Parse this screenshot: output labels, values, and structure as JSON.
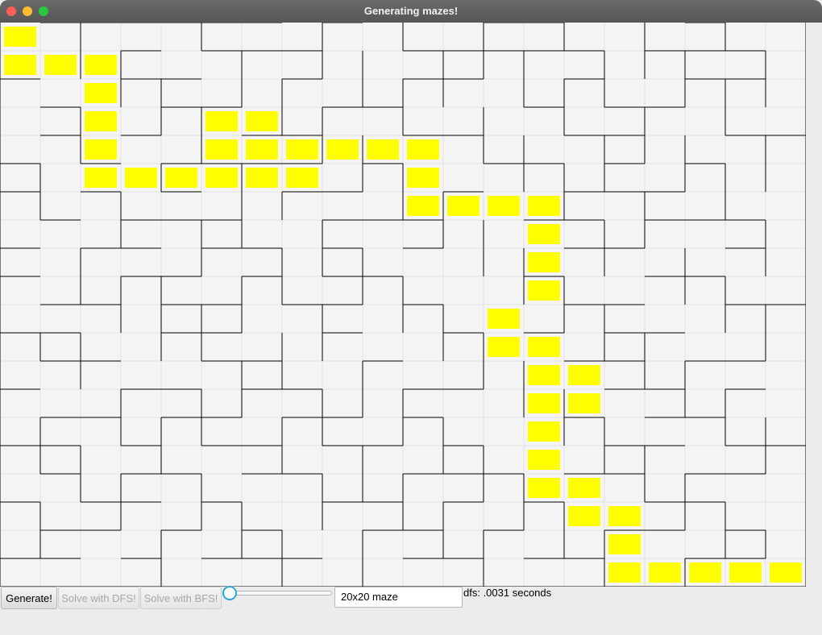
{
  "window": {
    "title": "Generating mazes!"
  },
  "colors": {
    "path": "#ffff00",
    "wall": "#000000",
    "cell_bg": "#f4f4f4",
    "grid_line": "#e2e2e2"
  },
  "maze": {
    "rows": 20,
    "cols": 20,
    "solution_path": [
      [
        0,
        0
      ],
      [
        1,
        0
      ],
      [
        1,
        1
      ],
      [
        1,
        2
      ],
      [
        2,
        2
      ],
      [
        3,
        2
      ],
      [
        4,
        2
      ],
      [
        5,
        2
      ],
      [
        5,
        3
      ],
      [
        5,
        4
      ],
      [
        5,
        5
      ],
      [
        4,
        5
      ],
      [
        3,
        5
      ],
      [
        3,
        6
      ],
      [
        4,
        6
      ],
      [
        5,
        6
      ],
      [
        5,
        7
      ],
      [
        4,
        7
      ],
      [
        4,
        8
      ],
      [
        4,
        9
      ],
      [
        4,
        10
      ],
      [
        5,
        10
      ],
      [
        6,
        10
      ],
      [
        6,
        11
      ],
      [
        6,
        12
      ],
      [
        6,
        13
      ],
      [
        7,
        13
      ],
      [
        8,
        13
      ],
      [
        9,
        13
      ],
      [
        10,
        12
      ],
      [
        11,
        12
      ],
      [
        11,
        13
      ],
      [
        12,
        13
      ],
      [
        12,
        14
      ],
      [
        13,
        14
      ],
      [
        13,
        13
      ],
      [
        14,
        13
      ],
      [
        15,
        13
      ],
      [
        16,
        13
      ],
      [
        16,
        14
      ],
      [
        17,
        14
      ],
      [
        17,
        15
      ],
      [
        18,
        15
      ],
      [
        19,
        15
      ],
      [
        19,
        16
      ],
      [
        19,
        17
      ],
      [
        19,
        18
      ],
      [
        19,
        19
      ]
    ],
    "horizontal_walls": [
      [
        0,
        1,
        7
      ],
      [
        0,
        8,
        9
      ],
      [
        0,
        12,
        14
      ],
      [
        0,
        17,
        18
      ],
      [
        1,
        3,
        4
      ],
      [
        1,
        5,
        8
      ],
      [
        1,
        10,
        15
      ],
      [
        1,
        16,
        19
      ],
      [
        2,
        0,
        1
      ],
      [
        2,
        3,
        5
      ],
      [
        2,
        7,
        8
      ],
      [
        2,
        10,
        12
      ],
      [
        2,
        14,
        15
      ],
      [
        2,
        17,
        19
      ],
      [
        3,
        1,
        2
      ],
      [
        3,
        4,
        6
      ],
      [
        3,
        8,
        10
      ],
      [
        3,
        13,
        14
      ],
      [
        3,
        15,
        17
      ],
      [
        4,
        1,
        2
      ],
      [
        4,
        3,
        4
      ],
      [
        4,
        6,
        8
      ],
      [
        4,
        10,
        12
      ],
      [
        4,
        14,
        16
      ],
      [
        4,
        18,
        20
      ],
      [
        5,
        0,
        1
      ],
      [
        5,
        2,
        3
      ],
      [
        5,
        4,
        8
      ],
      [
        5,
        9,
        10
      ],
      [
        5,
        12,
        14
      ],
      [
        5,
        15,
        16
      ],
      [
        5,
        17,
        18
      ],
      [
        6,
        0,
        1
      ],
      [
        6,
        2,
        3
      ],
      [
        6,
        4,
        5
      ],
      [
        6,
        7,
        9
      ],
      [
        6,
        11,
        12
      ],
      [
        6,
        14,
        17
      ],
      [
        7,
        1,
        2
      ],
      [
        7,
        3,
        6
      ],
      [
        7,
        8,
        11
      ],
      [
        7,
        13,
        15
      ],
      [
        7,
        16,
        19
      ],
      [
        8,
        0,
        1
      ],
      [
        8,
        2,
        4
      ],
      [
        8,
        5,
        7
      ],
      [
        8,
        8,
        9
      ],
      [
        8,
        10,
        11
      ],
      [
        8,
        14,
        16
      ],
      [
        8,
        18,
        19
      ],
      [
        9,
        0,
        1
      ],
      [
        9,
        3,
        5
      ],
      [
        9,
        6,
        7
      ],
      [
        9,
        8,
        10
      ],
      [
        9,
        13,
        14
      ],
      [
        9,
        16,
        18
      ],
      [
        10,
        1,
        3
      ],
      [
        10,
        4,
        6
      ],
      [
        10,
        7,
        9
      ],
      [
        10,
        10,
        11
      ],
      [
        10,
        14,
        16
      ],
      [
        10,
        18,
        20
      ],
      [
        11,
        0,
        2
      ],
      [
        11,
        4,
        6
      ],
      [
        11,
        8,
        9
      ],
      [
        11,
        11,
        12
      ],
      [
        11,
        13,
        14
      ],
      [
        11,
        15,
        17
      ],
      [
        12,
        1,
        3
      ],
      [
        12,
        5,
        7
      ],
      [
        12,
        9,
        10
      ],
      [
        12,
        14,
        16
      ],
      [
        12,
        17,
        19
      ],
      [
        13,
        0,
        1
      ],
      [
        13,
        3,
        5
      ],
      [
        13,
        6,
        8
      ],
      [
        13,
        10,
        12
      ],
      [
        13,
        15,
        17
      ],
      [
        13,
        18,
        19
      ],
      [
        14,
        1,
        3
      ],
      [
        14,
        4,
        6
      ],
      [
        14,
        7,
        9
      ],
      [
        14,
        10,
        11
      ],
      [
        14,
        14,
        15
      ],
      [
        14,
        16,
        18
      ],
      [
        15,
        0,
        2
      ],
      [
        15,
        3,
        4
      ],
      [
        15,
        5,
        7
      ],
      [
        15,
        8,
        10
      ],
      [
        15,
        11,
        12
      ],
      [
        15,
        15,
        17
      ],
      [
        15,
        18,
        20
      ],
      [
        16,
        1,
        2
      ],
      [
        16,
        3,
        5
      ],
      [
        16,
        6,
        8
      ],
      [
        16,
        10,
        13
      ],
      [
        16,
        14,
        16
      ],
      [
        16,
        17,
        19
      ],
      [
        17,
        0,
        1
      ],
      [
        17,
        2,
        4
      ],
      [
        17,
        5,
        6
      ],
      [
        17,
        8,
        10
      ],
      [
        17,
        11,
        12
      ],
      [
        17,
        13,
        14
      ],
      [
        17,
        16,
        18
      ],
      [
        18,
        1,
        3
      ],
      [
        18,
        4,
        5
      ],
      [
        18,
        6,
        7
      ],
      [
        18,
        9,
        11
      ],
      [
        18,
        12,
        13
      ],
      [
        18,
        15,
        17
      ],
      [
        18,
        18,
        19
      ],
      [
        19,
        0,
        2
      ],
      [
        19,
        3,
        4
      ],
      [
        19,
        5,
        8
      ],
      [
        19,
        10,
        12
      ],
      [
        19,
        13,
        15
      ],
      [
        19,
        17,
        19
      ]
    ],
    "vertical_walls": [
      [
        0,
        0,
        20
      ],
      [
        20,
        0,
        20
      ],
      [
        1,
        5,
        7
      ],
      [
        1,
        11,
        12
      ],
      [
        1,
        14,
        16
      ],
      [
        1,
        17,
        19
      ],
      [
        2,
        0,
        2
      ],
      [
        2,
        3,
        5
      ],
      [
        2,
        8,
        10
      ],
      [
        2,
        11,
        13
      ],
      [
        2,
        15,
        17
      ],
      [
        3,
        1,
        3
      ],
      [
        3,
        6,
        8
      ],
      [
        3,
        9,
        11
      ],
      [
        3,
        13,
        15
      ],
      [
        3,
        16,
        18
      ],
      [
        4,
        2,
        4
      ],
      [
        4,
        5,
        6
      ],
      [
        4,
        9,
        12
      ],
      [
        4,
        14,
        16
      ],
      [
        4,
        18,
        20
      ],
      [
        5,
        0,
        1
      ],
      [
        5,
        3,
        5
      ],
      [
        5,
        7,
        9
      ],
      [
        5,
        10,
        12
      ],
      [
        5,
        13,
        15
      ],
      [
        5,
        16,
        18
      ],
      [
        6,
        1,
        3
      ],
      [
        6,
        5,
        8
      ],
      [
        6,
        9,
        11
      ],
      [
        6,
        12,
        14
      ],
      [
        6,
        17,
        19
      ],
      [
        7,
        2,
        4
      ],
      [
        7,
        6,
        7
      ],
      [
        7,
        8,
        10
      ],
      [
        7,
        11,
        13
      ],
      [
        7,
        14,
        16
      ],
      [
        7,
        18,
        20
      ],
      [
        8,
        0,
        2
      ],
      [
        8,
        3,
        5
      ],
      [
        8,
        7,
        9
      ],
      [
        8,
        10,
        12
      ],
      [
        8,
        13,
        15
      ],
      [
        8,
        16,
        18
      ],
      [
        9,
        1,
        3
      ],
      [
        9,
        4,
        6
      ],
      [
        9,
        8,
        10
      ],
      [
        9,
        12,
        14
      ],
      [
        9,
        15,
        17
      ],
      [
        9,
        18,
        20
      ],
      [
        10,
        0,
        1
      ],
      [
        10,
        2,
        4
      ],
      [
        10,
        5,
        7
      ],
      [
        10,
        9,
        11
      ],
      [
        10,
        13,
        15
      ],
      [
        10,
        16,
        18
      ],
      [
        11,
        1,
        3
      ],
      [
        11,
        6,
        8
      ],
      [
        11,
        10,
        12
      ],
      [
        11,
        14,
        16
      ],
      [
        11,
        17,
        19
      ],
      [
        12,
        0,
        2
      ],
      [
        12,
        3,
        5
      ],
      [
        12,
        7,
        9
      ],
      [
        12,
        11,
        13
      ],
      [
        12,
        15,
        17
      ],
      [
        12,
        18,
        20
      ],
      [
        13,
        1,
        3
      ],
      [
        13,
        4,
        6
      ],
      [
        13,
        8,
        10
      ],
      [
        13,
        12,
        14
      ],
      [
        13,
        16,
        18
      ],
      [
        14,
        0,
        1
      ],
      [
        14,
        2,
        4
      ],
      [
        14,
        5,
        7
      ],
      [
        14,
        9,
        11
      ],
      [
        14,
        13,
        15
      ],
      [
        14,
        17,
        19
      ],
      [
        15,
        1,
        3
      ],
      [
        15,
        4,
        6
      ],
      [
        15,
        7,
        9
      ],
      [
        15,
        10,
        12
      ],
      [
        15,
        14,
        16
      ],
      [
        15,
        18,
        20
      ],
      [
        16,
        0,
        2
      ],
      [
        16,
        3,
        5
      ],
      [
        16,
        6,
        8
      ],
      [
        16,
        11,
        13
      ],
      [
        16,
        15,
        17
      ],
      [
        17,
        1,
        3
      ],
      [
        17,
        4,
        6
      ],
      [
        17,
        8,
        10
      ],
      [
        17,
        12,
        14
      ],
      [
        17,
        16,
        18
      ],
      [
        17,
        19,
        20
      ],
      [
        18,
        0,
        1
      ],
      [
        18,
        2,
        4
      ],
      [
        18,
        5,
        7
      ],
      [
        18,
        9,
        11
      ],
      [
        18,
        13,
        15
      ],
      [
        18,
        17,
        19
      ],
      [
        19,
        1,
        3
      ],
      [
        19,
        4,
        6
      ],
      [
        19,
        7,
        9
      ],
      [
        19,
        10,
        12
      ],
      [
        19,
        14,
        16
      ],
      [
        19,
        18,
        19
      ]
    ]
  },
  "controls": {
    "generate_label": "Generate!",
    "solve_dfs_label": "Solve with DFS!",
    "solve_bfs_label": "Solve with BFS!",
    "slider_value": 0,
    "size_value": "20x20 maze",
    "status_text": "dfs: .0031 seconds"
  }
}
